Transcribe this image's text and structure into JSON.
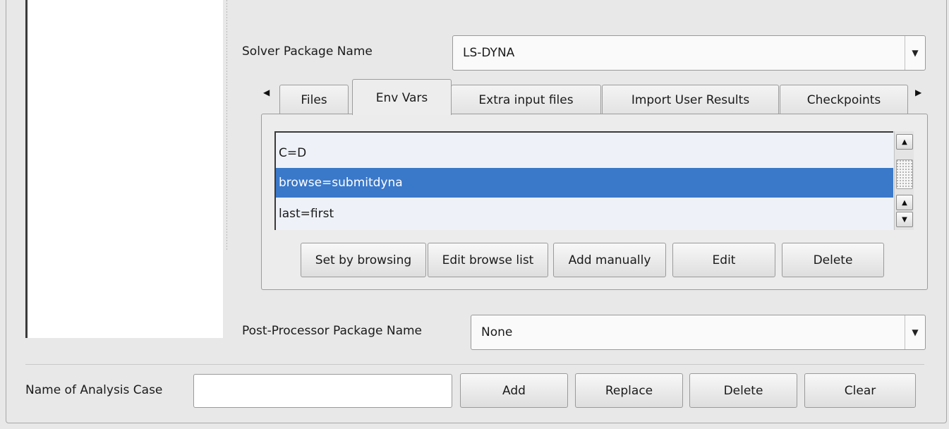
{
  "solver": {
    "label": "Solver Package Name",
    "value": "LS-DYNA"
  },
  "tabs": [
    {
      "label": "Files",
      "active": false
    },
    {
      "label": "Env Vars",
      "active": true
    },
    {
      "label": "Extra input files",
      "active": false
    },
    {
      "label": "Import User Results",
      "active": false
    },
    {
      "label": "Checkpoints",
      "active": false
    }
  ],
  "env_vars": {
    "items": [
      "C=D",
      "browse=submitdyna",
      "last=first"
    ],
    "selected_index": 1,
    "buttons": {
      "set_by_browsing": "Set by browsing",
      "edit_browse_list": "Edit browse list",
      "add_manually": "Add manually",
      "edit": "Edit",
      "delete": "Delete"
    }
  },
  "post_processor": {
    "label": "Post-Processor Package Name",
    "value": "None"
  },
  "analysis_case": {
    "label": "Name of Analysis Case",
    "value": "",
    "buttons": {
      "add": "Add",
      "replace": "Replace",
      "delete": "Delete",
      "clear": "Clear"
    }
  },
  "icons": {
    "dropdown": "triangle-down-icon",
    "tab_scroll_left": "triangle-left-icon",
    "tab_scroll_right": "triangle-right-icon",
    "scroll_up": "triangle-up-icon",
    "scroll_down": "triangle-down-icon"
  },
  "colors": {
    "selection": "#3a78c9",
    "background": "#e8e8e8"
  }
}
